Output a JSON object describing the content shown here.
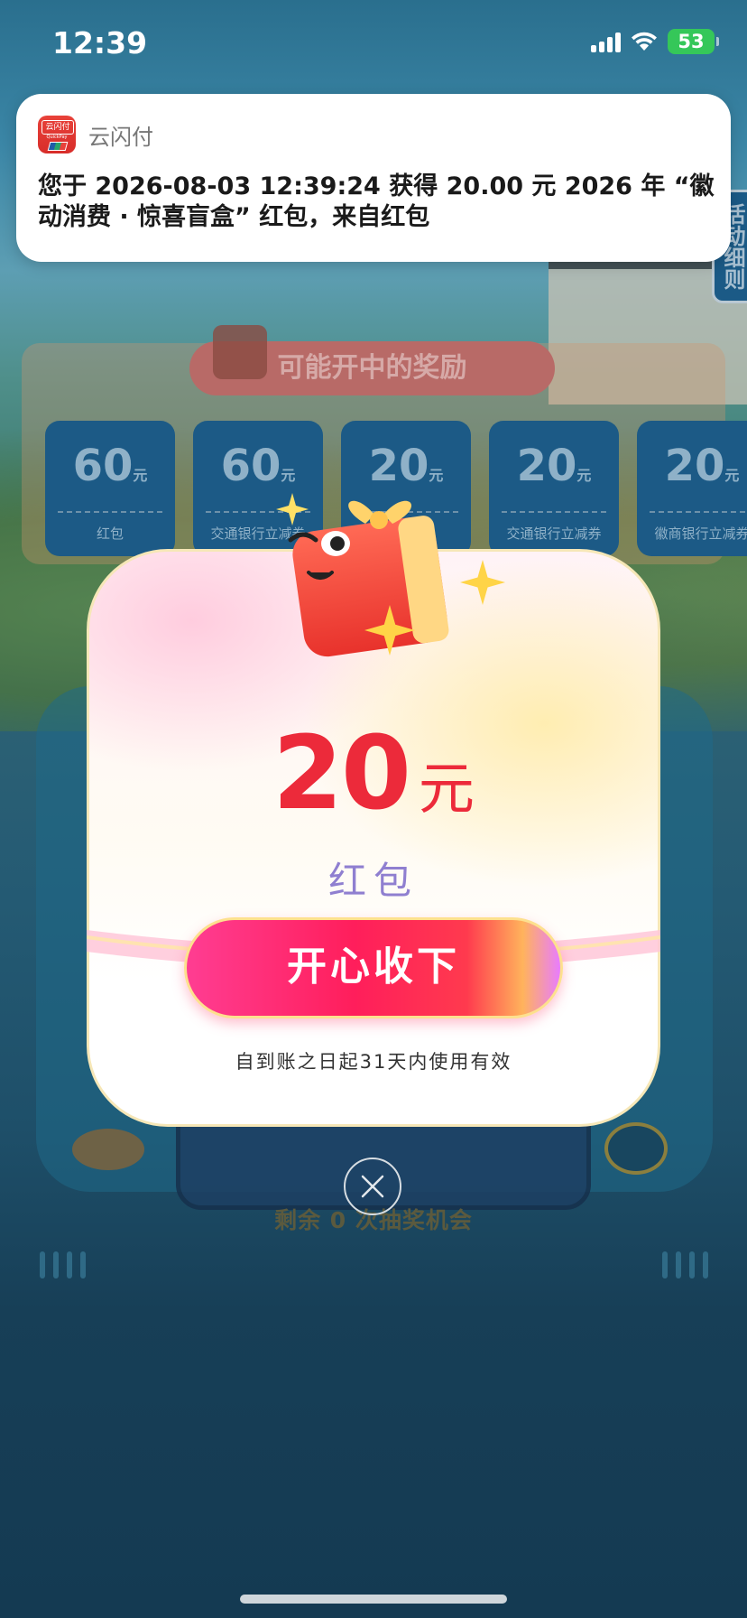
{
  "status_bar": {
    "time": "12:39",
    "battery": "53"
  },
  "notification": {
    "app_name": "云闪付",
    "app_icon_text": "云闪付",
    "app_icon_subtext": "QuickPay",
    "message": "您于 2026-08-03 12:39:24 获得 20.00 元 2026 年 “徽动消费 · 惊喜盲盒” 红包，来自红包"
  },
  "background": {
    "rules_tab": "活动细则",
    "rewards_title": "可能开中的奖励",
    "coupons": [
      {
        "amount": "60",
        "unit": "元",
        "label": "红包"
      },
      {
        "amount": "60",
        "unit": "元",
        "label": "交通银行立减券"
      },
      {
        "amount": "20",
        "unit": "元",
        "label": ""
      },
      {
        "amount": "20",
        "unit": "元",
        "label": "交通银行立减券"
      },
      {
        "amount": "20",
        "unit": "元",
        "label": "徽商银行立减券"
      }
    ],
    "draws_left": "剩余 0 次抽奖机会"
  },
  "modal": {
    "amount": "20",
    "unit": "元",
    "prize_type": "红包",
    "accept_label": "开心收下",
    "validity": "自到账之日起31天内使用有效"
  },
  "colors": {
    "accent_red": "#ec2a3a",
    "button_pink": "#ff1e5b",
    "prize_type_purple": "#8f7fd0",
    "battery_green": "#35c759"
  }
}
